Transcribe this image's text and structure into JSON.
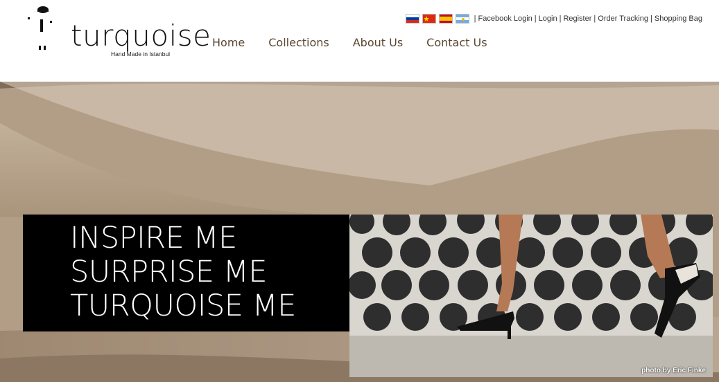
{
  "brand": {
    "name": "turquoise",
    "tagline": "Hand Made in Istanbul"
  },
  "nav": [
    {
      "label": "Home"
    },
    {
      "label": "Collections"
    },
    {
      "label": "About Us"
    },
    {
      "label": "Contact Us"
    }
  ],
  "flags": [
    {
      "icon": "russia-flag-icon"
    },
    {
      "icon": "china-flag-icon"
    },
    {
      "icon": "spain-flag-icon"
    },
    {
      "icon": "argentina-flag-icon"
    }
  ],
  "toplinks": [
    {
      "label": "Facebook Login"
    },
    {
      "label": "Login"
    },
    {
      "label": "Register"
    },
    {
      "label": "Order Tracking"
    },
    {
      "label": "Shopping Bag"
    }
  ],
  "banner": {
    "lines": [
      "INSPIRE ME",
      "SURPRISE ME",
      "TURQUOISE ME"
    ],
    "credit": "photo by Eric Finke"
  },
  "colors": {
    "nav_text": "#5a4632",
    "banner_bg": "#b7a48b",
    "slogan_box": "#000000"
  }
}
